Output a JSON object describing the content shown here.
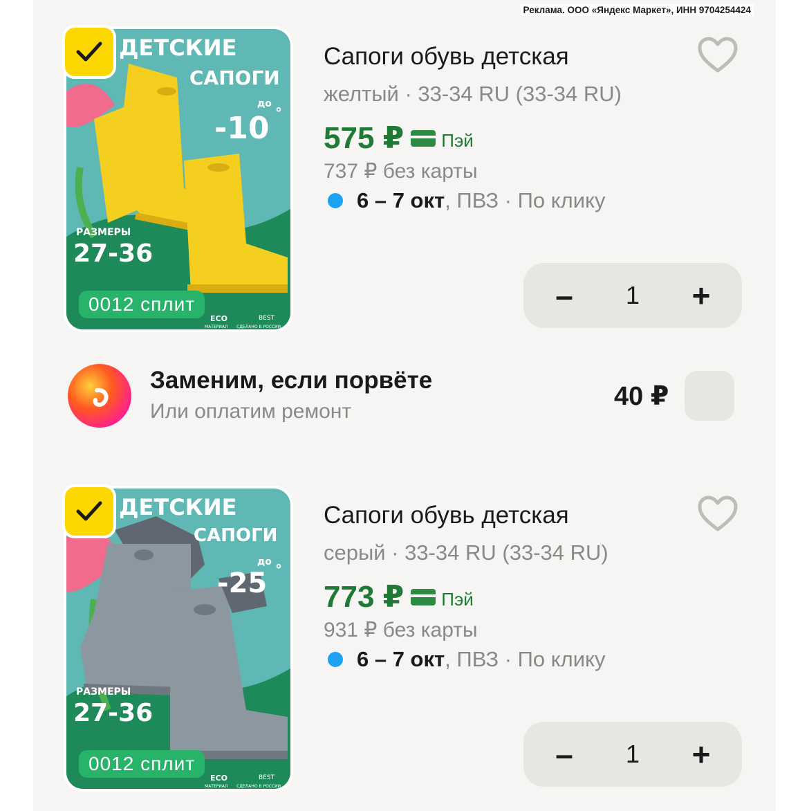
{
  "ad": {
    "text": "Реклама. ООО «Яндекс Маркет», ИНН 9704254424"
  },
  "items": [
    {
      "title": "Сапоги  обувь детская",
      "variant": "желтый · 33-34 RU (33-34 RU)",
      "price": "575 ₽",
      "pay_label": "Пэй",
      "old_price": "737 ₽  без карты",
      "delivery_date": "6 – 7 окт",
      "delivery_rest": ", ПВЗ · По клику",
      "quantity": "1",
      "minus": "–",
      "plus": "+",
      "image": {
        "heading1": "ДЕТСКИЕ",
        "heading2": "САПОГИ",
        "discount_prefix": "до",
        "discount": "-10",
        "sizes_label": "РАЗМЕРЫ",
        "sizes": "27-36",
        "split": "0012 сплит",
        "eco": "ECO",
        "eco_sub": "МАТЕРИАЛ",
        "brand": "BEST",
        "brand_sub": "СДЕЛАНО В РОССИИ",
        "boot_color": "#f4cf1f",
        "boot_shade": "#d9ad12"
      }
    },
    {
      "title": "Сапоги  обувь детская",
      "variant": "серый · 33-34 RU (33-34 RU)",
      "price": "773 ₽",
      "pay_label": "Пэй",
      "old_price": "931 ₽  без карты",
      "delivery_date": "6 – 7 окт",
      "delivery_rest": ", ПВЗ · По клику",
      "quantity": "1",
      "minus": "–",
      "plus": "+",
      "image": {
        "heading1": "ДЕТСКИЕ",
        "heading2": "САПОГИ",
        "discount_prefix": "до",
        "discount": "-25",
        "sizes_label": "РАЗМЕРЫ",
        "sizes": "27-36",
        "split": "0012 сплит",
        "eco": "ECO",
        "eco_sub": "МАТЕРИАЛ",
        "brand": "BEST",
        "brand_sub": "СДЕЛАНО В РОССИИ",
        "boot_color": "#8d979f",
        "boot_shade": "#6f7880"
      }
    }
  ],
  "insurance": {
    "title": "Заменим, если порвёте",
    "subtitle": "Или оплатим ремонт",
    "price": "40 ₽"
  },
  "colors": {
    "accent_yellow": "#fcd700",
    "price_green": "#1f7a36",
    "split_green": "#27b36a",
    "delivery_blue": "#1da1f2"
  }
}
